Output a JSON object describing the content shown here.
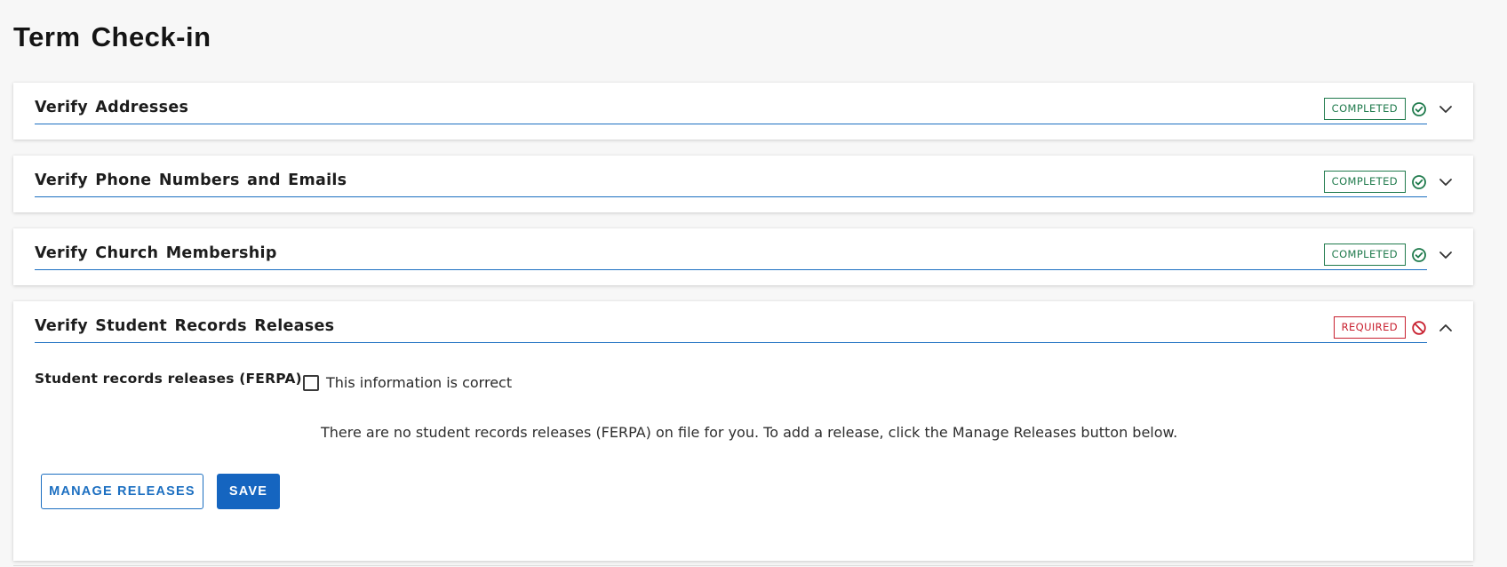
{
  "page": {
    "title": "Term Check-in"
  },
  "sections": [
    {
      "title": "Verify Addresses",
      "status": "COMPLETED",
      "status_icon": "check-circle-icon",
      "expanded": false
    },
    {
      "title": "Verify Phone Numbers and Emails",
      "status": "COMPLETED",
      "status_icon": "check-circle-icon",
      "expanded": false
    },
    {
      "title": "Verify Church Membership",
      "status": "COMPLETED",
      "status_icon": "check-circle-icon",
      "expanded": false
    },
    {
      "title": "Verify Student Records Releases",
      "status": "REQUIRED",
      "status_icon": "no-entry-icon",
      "expanded": true,
      "body": {
        "field_label": "Student records releases (FERPA)",
        "confirm_label": "This information is correct",
        "confirm_checked": false,
        "empty_message": "There are no student records releases (FERPA) on file for you. To add a release, click the Manage Releases button below.",
        "manage_button": "Manage Releases",
        "save_button": "Save"
      }
    }
  ],
  "colors": {
    "completed": "#1f7a4c",
    "required": "#c8202f",
    "accent": "#1c6fc1",
    "primary_button": "#1565c0"
  }
}
